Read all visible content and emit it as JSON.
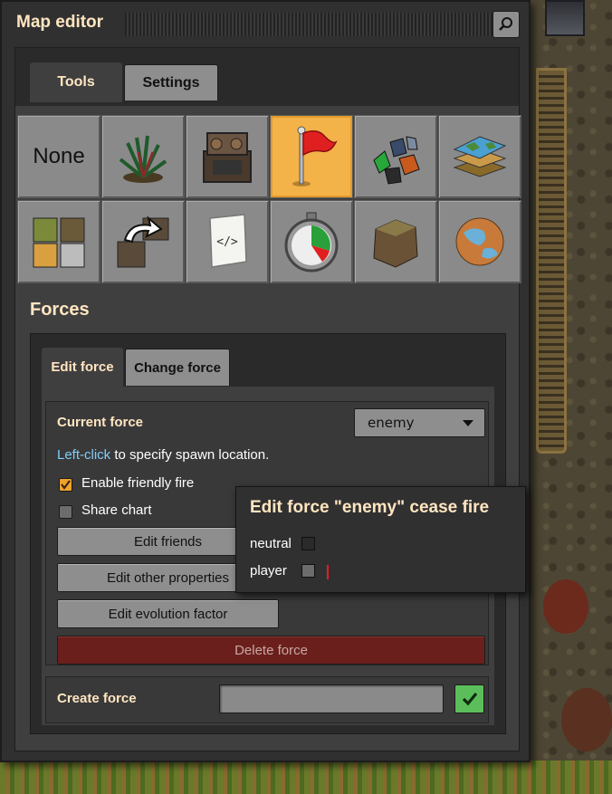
{
  "window": {
    "title": "Map editor"
  },
  "main_tabs": [
    {
      "label": "Tools",
      "active": true
    },
    {
      "label": "Settings",
      "active": false
    }
  ],
  "tools": [
    {
      "icon": "none",
      "label": "None",
      "selected": false
    },
    {
      "icon": "decoratives-plant-icon",
      "selected": false
    },
    {
      "icon": "entity-machine-icon",
      "selected": false
    },
    {
      "icon": "forces-flag-icon",
      "selected": true
    },
    {
      "icon": "resources-ore-icon",
      "selected": false
    },
    {
      "icon": "tiles-layers-icon",
      "selected": false
    },
    {
      "icon": "terrain-tiles-icon",
      "selected": false
    },
    {
      "icon": "clone-entity-arrow-icon",
      "selected": false
    },
    {
      "icon": "script-scroll-icon",
      "selected": false
    },
    {
      "icon": "time-stopwatch-icon",
      "selected": false
    },
    {
      "icon": "cliff-rock-icon",
      "selected": false
    },
    {
      "icon": "surface-planet-icon",
      "selected": false
    }
  ],
  "forces": {
    "section_title": "Forces",
    "tabs": [
      {
        "label": "Edit force",
        "active": true
      },
      {
        "label": "Change force",
        "active": false
      }
    ],
    "current_force_label": "Current force",
    "current_force_value": "enemy",
    "hint_link": "Left-click",
    "hint_rest": " to specify spawn location.",
    "friendly_fire": {
      "label": "Enable friendly fire",
      "checked": true
    },
    "share_chart": {
      "label": "Share chart",
      "checked": false
    },
    "buttons": {
      "edit_friends": "Edit friends",
      "edit_other": "Edit other properties",
      "edit_evolution": "Edit evolution factor",
      "delete": "Delete force"
    },
    "create_label": "Create force",
    "create_value": ""
  },
  "popup": {
    "title": "Edit force \"enemy\" cease fire",
    "rows": [
      {
        "label": "neutral",
        "checked": false
      },
      {
        "label": "player",
        "checked": false
      }
    ]
  },
  "colors": {
    "accent_orange": "#f4b349",
    "title_text": "#ffe6c0",
    "link": "#7fcdf8",
    "delete_red": "#6a1f1c",
    "confirm_green": "#5cbe5a"
  }
}
